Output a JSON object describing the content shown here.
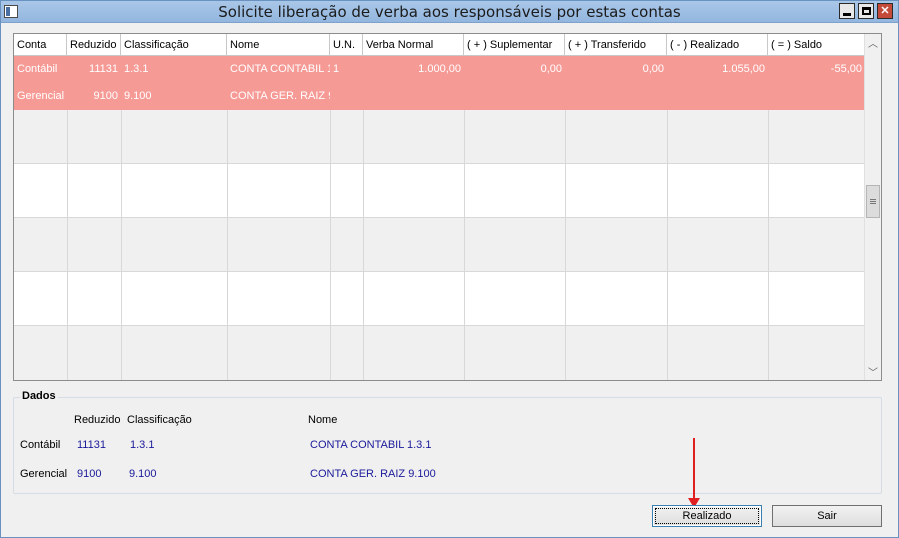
{
  "window": {
    "title": "Solicite liberação de verba aos responsáveis por estas contas"
  },
  "grid": {
    "columns": [
      "Conta",
      "Reduzido",
      "Classificação",
      "Nome",
      "U.N.",
      "Verba Normal",
      "( + ) Suplementar",
      "( + ) Transferido",
      "( - ) Realizado",
      "( = ) Saldo"
    ],
    "rows": [
      {
        "conta": "Contábil",
        "reduzido": "11131",
        "classificacao": "1.3.1",
        "nome": "CONTA CONTABIL 1.",
        "un": "1",
        "verba": "1.000,00",
        "suplementar": "0,00",
        "transferido": "0,00",
        "realizado": "1.055,00",
        "saldo": "-55,00"
      },
      {
        "conta": "Gerencial",
        "reduzido": "9100",
        "classificacao": "9.100",
        "nome": "CONTA GER. RAIZ 9.",
        "un": "",
        "verba": "",
        "suplementar": "",
        "transferido": "",
        "realizado": "",
        "saldo": ""
      }
    ],
    "row_color": "#f69a96"
  },
  "dados": {
    "legend": "Dados",
    "headers": {
      "reduzido": "Reduzido",
      "classificacao": "Classificação",
      "nome": "Nome"
    },
    "contabil": {
      "label": "Contábil",
      "reduzido": "11131",
      "classificacao": "1.3.1",
      "nome": "CONTA CONTABIL 1.3.1"
    },
    "gerencial": {
      "label": "Gerencial",
      "reduzido": "9100",
      "classificacao": "9.100",
      "nome": "CONTA GER. RAIZ 9.100"
    }
  },
  "buttons": {
    "realizado": "Realizado",
    "sair": "Sair"
  },
  "icons": {
    "window": "app-icon",
    "minimize": "minimize-icon",
    "maximize": "maximize-icon",
    "close": "close-icon",
    "scroll_up": "chevron-up-icon",
    "scroll_down": "chevron-down-icon"
  },
  "annotation_color": "#e02020"
}
